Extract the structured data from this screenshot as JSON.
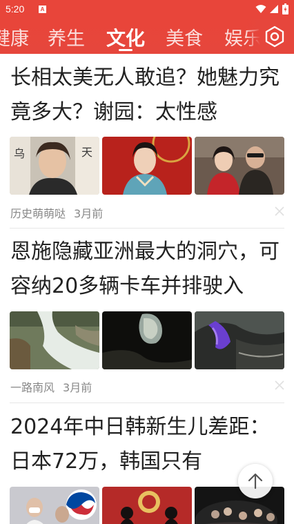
{
  "status_bar": {
    "time": "5:20",
    "app_icon_letter": "A",
    "icons": [
      "wifi-icon",
      "cellular-signal-icon",
      "battery-icon"
    ]
  },
  "tabs": [
    {
      "label": "健康",
      "active": false
    },
    {
      "label": "养生",
      "active": false
    },
    {
      "label": "文化",
      "active": true
    },
    {
      "label": "美食",
      "active": false
    },
    {
      "label": "娱乐",
      "active": false
    }
  ],
  "colors": {
    "brand_red": "#e8453a",
    "text_primary": "#222222",
    "text_meta": "#888888"
  },
  "articles": [
    {
      "title": "长相太美无人敢追？她魅力究竟多大？谢园：太性感",
      "source": "历史萌萌哒",
      "time": "3月前",
      "thumbnails": [
        "woman-portrait-photo",
        "woman-in-red-stage-photo",
        "couple-photo"
      ]
    },
    {
      "title": "恩施隐藏亚洲最大的洞穴，可容纳20多辆卡车并排驶入",
      "source": "一路南风",
      "time": "3月前",
      "thumbnails": [
        "waterfall-photo",
        "cave-entrance-photo",
        "illuminated-cave-photo"
      ]
    },
    {
      "title": "2024年中日韩新生儿差距：日本72万，韩国只有",
      "source": "",
      "time": "",
      "thumbnails": [
        "korea-flag-crowd-photo",
        "national-emblem-photo",
        "dark-crowd-photo"
      ]
    }
  ],
  "icons": {
    "settings": "settings-icon",
    "dismiss": "close-icon",
    "scroll_top": "arrow-up-icon"
  }
}
